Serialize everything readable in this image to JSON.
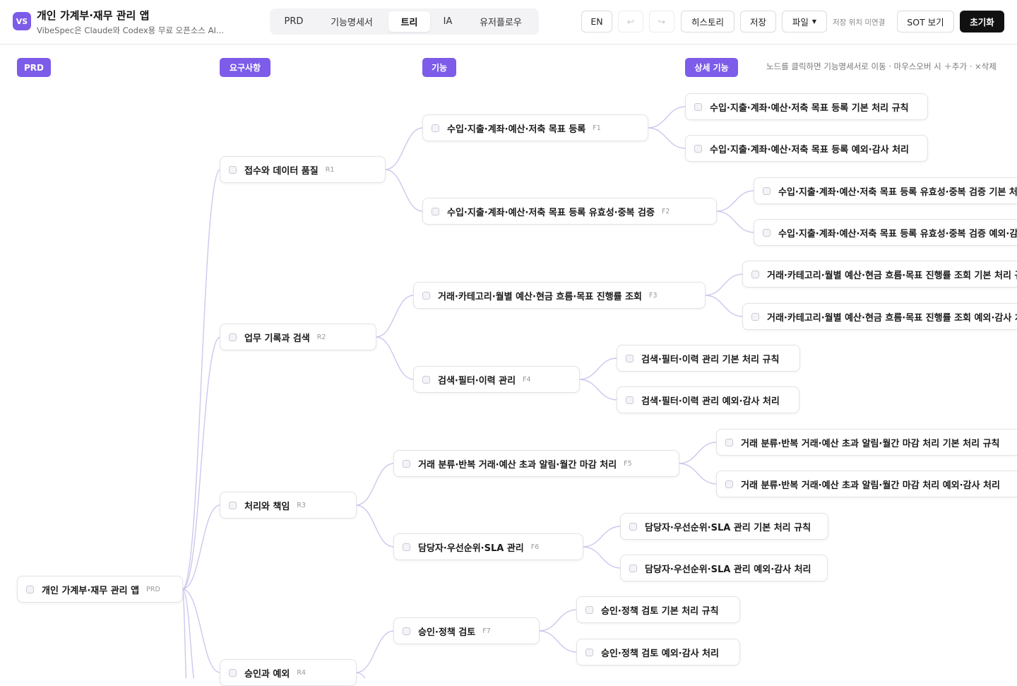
{
  "header": {
    "logo": "VS",
    "title": "개인 가계부·재무 관리 앱",
    "subtitle": "VibeSpec은 Claude와 Codex용 무료 오픈소스 AI...",
    "tabs": [
      {
        "label": "PRD",
        "active": false
      },
      {
        "label": "기능명세서",
        "active": false
      },
      {
        "label": "트리",
        "active": true
      },
      {
        "label": "IA",
        "active": false
      },
      {
        "label": "유저플로우",
        "active": false
      }
    ],
    "lang_button": "EN",
    "undo_icon": "undo-icon",
    "redo_icon": "redo-icon",
    "history_button": "히스토리",
    "save_button": "저장",
    "file_menu": "파일",
    "save_location": "저장 위치 미연결",
    "sot_button": "SOT 보기",
    "reset_button": "초기화"
  },
  "columns": {
    "prd": "PRD",
    "requirements": "요구사항",
    "features": "기능",
    "details": "상세 기능"
  },
  "hint": "노드를 클릭하면 기능명세서로 이동 · 마우스오버 시 ＋추가 · ×삭제",
  "tree": {
    "root": {
      "label": "개인 가계부·재무 관리 앱",
      "code": "PRD"
    },
    "requirements": [
      {
        "label": "접수와 데이터 품질",
        "code": "R1"
      },
      {
        "label": "업무 기록과 검색",
        "code": "R2"
      },
      {
        "label": "처리와 책임",
        "code": "R3"
      },
      {
        "label": "승인과 예외",
        "code": "R4"
      }
    ],
    "features": [
      {
        "label": "수입·지출·계좌·예산·저축 목표 등록",
        "code": "F1"
      },
      {
        "label": "수입·지출·계좌·예산·저축 목표 등록 유효성·중복 검증",
        "code": "F2"
      },
      {
        "label": "거래·카테고리·월별 예산·현금 흐름·목표 진행률 조회",
        "code": "F3"
      },
      {
        "label": "검색·필터·이력 관리",
        "code": "F4"
      },
      {
        "label": "거래 분류·반복 거래·예산 초과 알림·월간 마감 처리",
        "code": "F5"
      },
      {
        "label": "담당자·우선순위·SLA 관리",
        "code": "F6"
      },
      {
        "label": "승인·정책 검토",
        "code": "F7"
      }
    ],
    "details": [
      {
        "label": "수입·지출·계좌·예산·저축 목표 등록 기본 처리 규칙"
      },
      {
        "label": "수입·지출·계좌·예산·저축 목표 등록 예외·감사 처리"
      },
      {
        "label": "수입·지출·계좌·예산·저축 목표 등록 유효성·중복 검증 기본 처리 규칙"
      },
      {
        "label": "수입·지출·계좌·예산·저축 목표 등록 유효성·중복 검증 예외·감사 처리"
      },
      {
        "label": "거래·카테고리·월별 예산·현금 흐름·목표 진행률 조회 기본 처리 규칙"
      },
      {
        "label": "거래·카테고리·월별 예산·현금 흐름·목표 진행률 조회 예외·감사 처리"
      },
      {
        "label": "검색·필터·이력 관리 기본 처리 규칙"
      },
      {
        "label": "검색·필터·이력 관리 예외·감사 처리"
      },
      {
        "label": "거래 분류·반복 거래·예산 초과 알림·월간 마감 처리 기본 처리 규칙"
      },
      {
        "label": "거래 분류·반복 거래·예산 초과 알림·월간 마감 처리 예외·감사 처리"
      },
      {
        "label": "담당자·우선순위·SLA 관리 기본 처리 규칙"
      },
      {
        "label": "담당자·우선순위·SLA 관리 예외·감사 처리"
      },
      {
        "label": "승인·정책 검토 기본 처리 규칙"
      },
      {
        "label": "승인·정책 검토 예외·감사 처리"
      }
    ]
  },
  "colors": {
    "accent": "#7c5ce8",
    "edge": "#cfc6ee",
    "dark": "#111111"
  }
}
